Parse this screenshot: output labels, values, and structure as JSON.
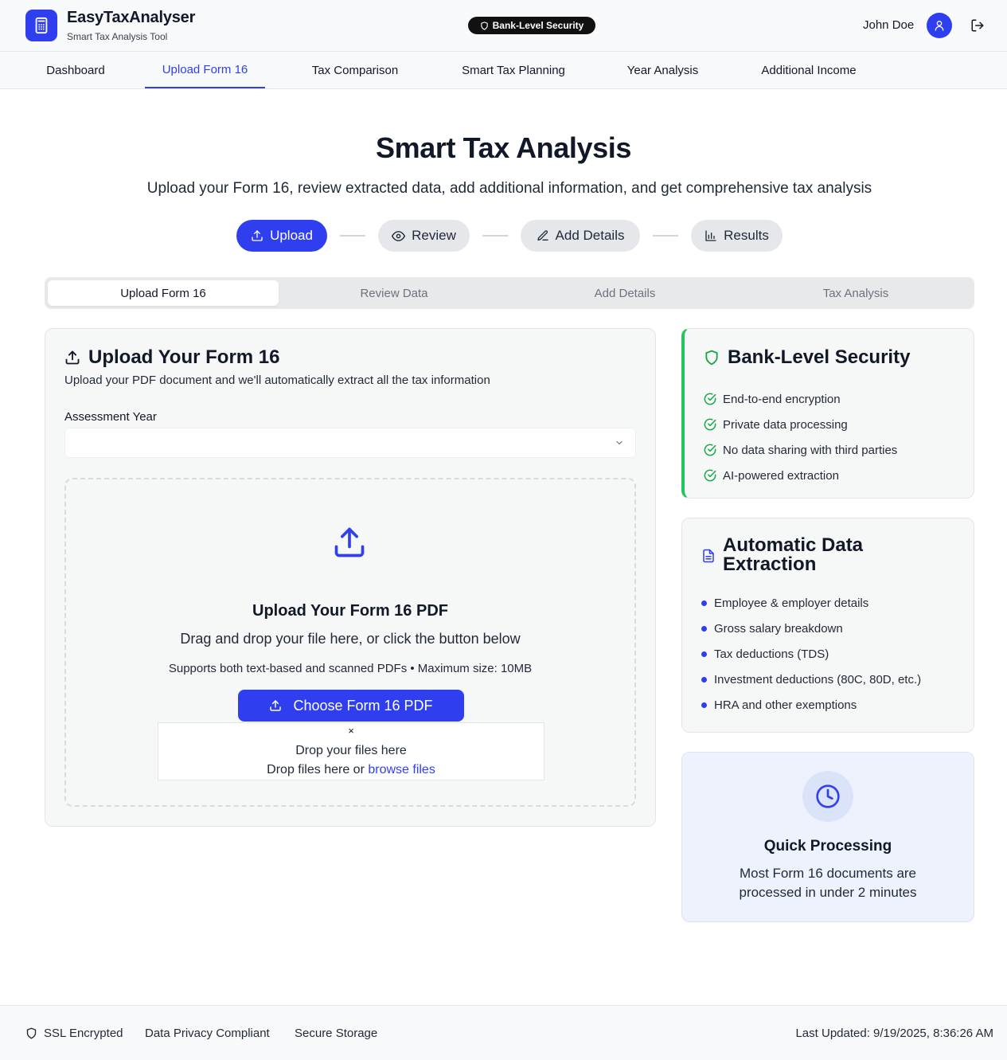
{
  "header": {
    "app_title": "EasyTaxAnalyser",
    "app_subtitle": "Smart Tax Analysis Tool",
    "security_badge": "Bank-Level Security",
    "user_name": "John Doe"
  },
  "nav": {
    "items": [
      {
        "label": "Dashboard"
      },
      {
        "label": "Upload Form 16",
        "active": true
      },
      {
        "label": "Tax Comparison"
      },
      {
        "label": "Smart Tax Planning"
      },
      {
        "label": "Year Analysis"
      },
      {
        "label": "Additional Income"
      }
    ]
  },
  "hero": {
    "title": "Smart Tax Analysis",
    "subtitle": "Upload your Form 16, review extracted data, add additional information, and get comprehensive tax analysis"
  },
  "steps": [
    {
      "label": "Upload",
      "icon": "upload-icon",
      "active": true
    },
    {
      "label": "Review",
      "icon": "eye-icon"
    },
    {
      "label": "Add Details",
      "icon": "pencil-icon"
    },
    {
      "label": "Results",
      "icon": "bar-chart-icon"
    }
  ],
  "tabs": [
    {
      "label": "Upload Form 16",
      "active": true
    },
    {
      "label": "Review Data"
    },
    {
      "label": "Add Details"
    },
    {
      "label": "Tax Analysis"
    }
  ],
  "upload_card": {
    "title": "Upload Your Form 16",
    "description": "Upload your PDF document and we'll automatically extract all the tax information",
    "assessment_year_label": "Assessment Year",
    "assessment_year_value": "",
    "dropzone": {
      "title": "Upload Your Form 16 PDF",
      "subtitle": "Drag and drop your file here, or click the button below",
      "note": "Supports both text-based and scanned PDFs • Maximum size: 10MB",
      "button_label": "Choose Form 16 PDF",
      "close_glyph": "×",
      "drop_line1": "Drop your files here",
      "drop_line2_prefix": "Drop files here or ",
      "drop_link": "browse files"
    }
  },
  "security_card": {
    "title": "Bank-Level Security",
    "items": [
      "End-to-end encryption",
      "Private data processing",
      "No data sharing with third parties",
      "AI-powered extraction"
    ]
  },
  "extraction_card": {
    "title": "Automatic Data Extraction",
    "items": [
      "Employee & employer details",
      "Gross salary breakdown",
      "Tax deductions (TDS)",
      "Investment deductions (80C, 80D, etc.)",
      "HRA and other exemptions"
    ]
  },
  "quick_card": {
    "title": "Quick Processing",
    "description": "Most Form 16 documents are processed in under 2 minutes"
  },
  "footer": {
    "ssl": "SSL Encrypted",
    "privacy": "Data Privacy Compliant",
    "storage": "Secure Storage",
    "last_updated": "Last Updated: 9/19/2025, 8:36:26 AM"
  },
  "colors": {
    "accent": "#2f3ff0",
    "success": "#22c55e"
  }
}
